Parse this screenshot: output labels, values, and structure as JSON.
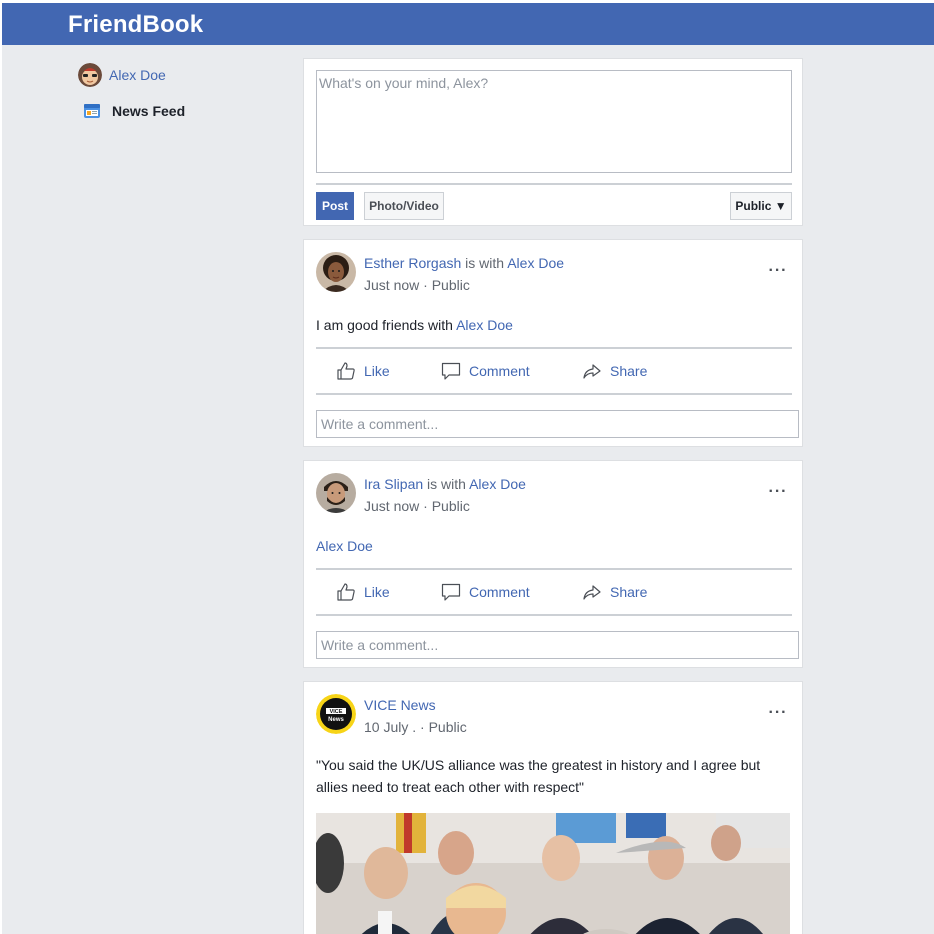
{
  "app": {
    "brand": "FriendBook"
  },
  "sidebar": {
    "user_name": "Alex Doe",
    "news_feed_label": "News Feed"
  },
  "composer": {
    "placeholder": "What's on your mind, Alex?",
    "post_label": "Post",
    "photo_label": "Photo/Video",
    "privacy_label": "Public ▼"
  },
  "actions": {
    "like": "Like",
    "comment": "Comment",
    "share": "Share",
    "comment_placeholder": "Write a comment..."
  },
  "posts": [
    {
      "author": "Esther Rorgash",
      "with_text": "is with",
      "tagged": "Alex Doe",
      "time": "Just now",
      "privacy": "· Public",
      "text_prefix": "I am good friends with ",
      "text_link": "Alex Doe",
      "more": "···"
    },
    {
      "author": "Ira Slipan",
      "with_text": "is with",
      "tagged": "Alex Doe",
      "time": "Just now",
      "privacy": "· Public",
      "text_link": "Alex Doe",
      "more": "···"
    },
    {
      "author": "VICE News",
      "avatar_text": "VICE News",
      "time": "10 July .",
      "privacy": "· Public",
      "text": "\"You said the UK/US alliance was the greatest in history and I agree but allies need to treat each other with respect\"",
      "more": "···"
    }
  ],
  "colors": {
    "header": "#4267b2",
    "link": "#4267b2",
    "background": "#e9ebee"
  }
}
